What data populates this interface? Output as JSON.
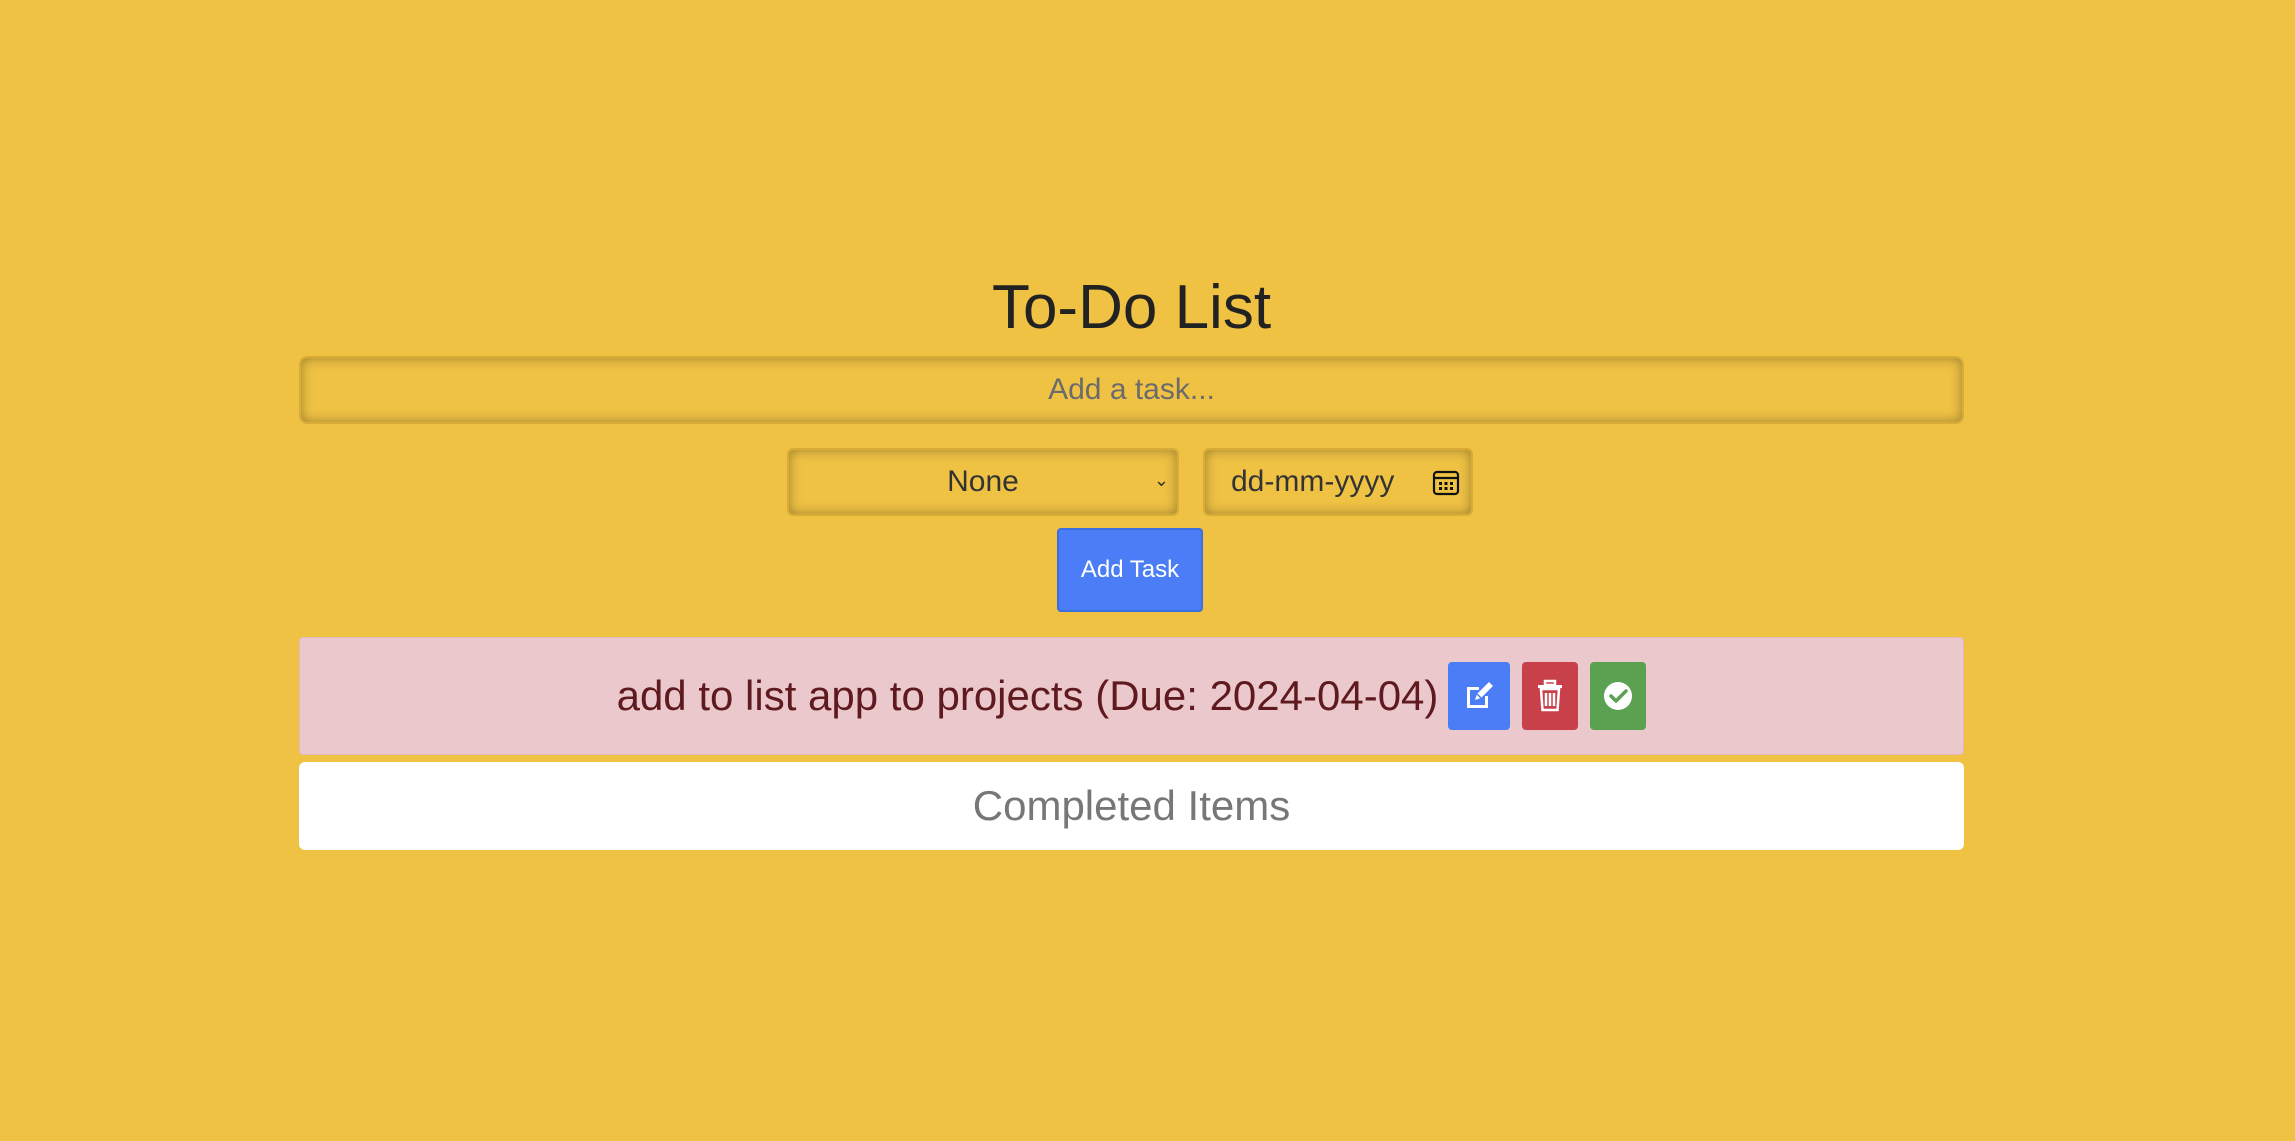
{
  "header": {
    "title": "To-Do List"
  },
  "form": {
    "task_placeholder": "Add a task...",
    "priority_selected": "None",
    "date_placeholder": "dd-mm-yyyy",
    "add_button_label": "Add Task"
  },
  "tasks": [
    {
      "text": "add to list app to projects (Due: 2024-04-04)",
      "actions": {
        "edit_icon": "edit-icon",
        "delete_icon": "trash-icon",
        "complete_icon": "check-circle-icon"
      }
    }
  ],
  "completed_section": {
    "title": "Completed Items"
  },
  "colors": {
    "background": "#EFC244",
    "accent_blue": "#4A7DF6",
    "danger_red": "#C8404A",
    "success_green": "#5BA152",
    "task_row_bg": "#EAC8CC"
  }
}
